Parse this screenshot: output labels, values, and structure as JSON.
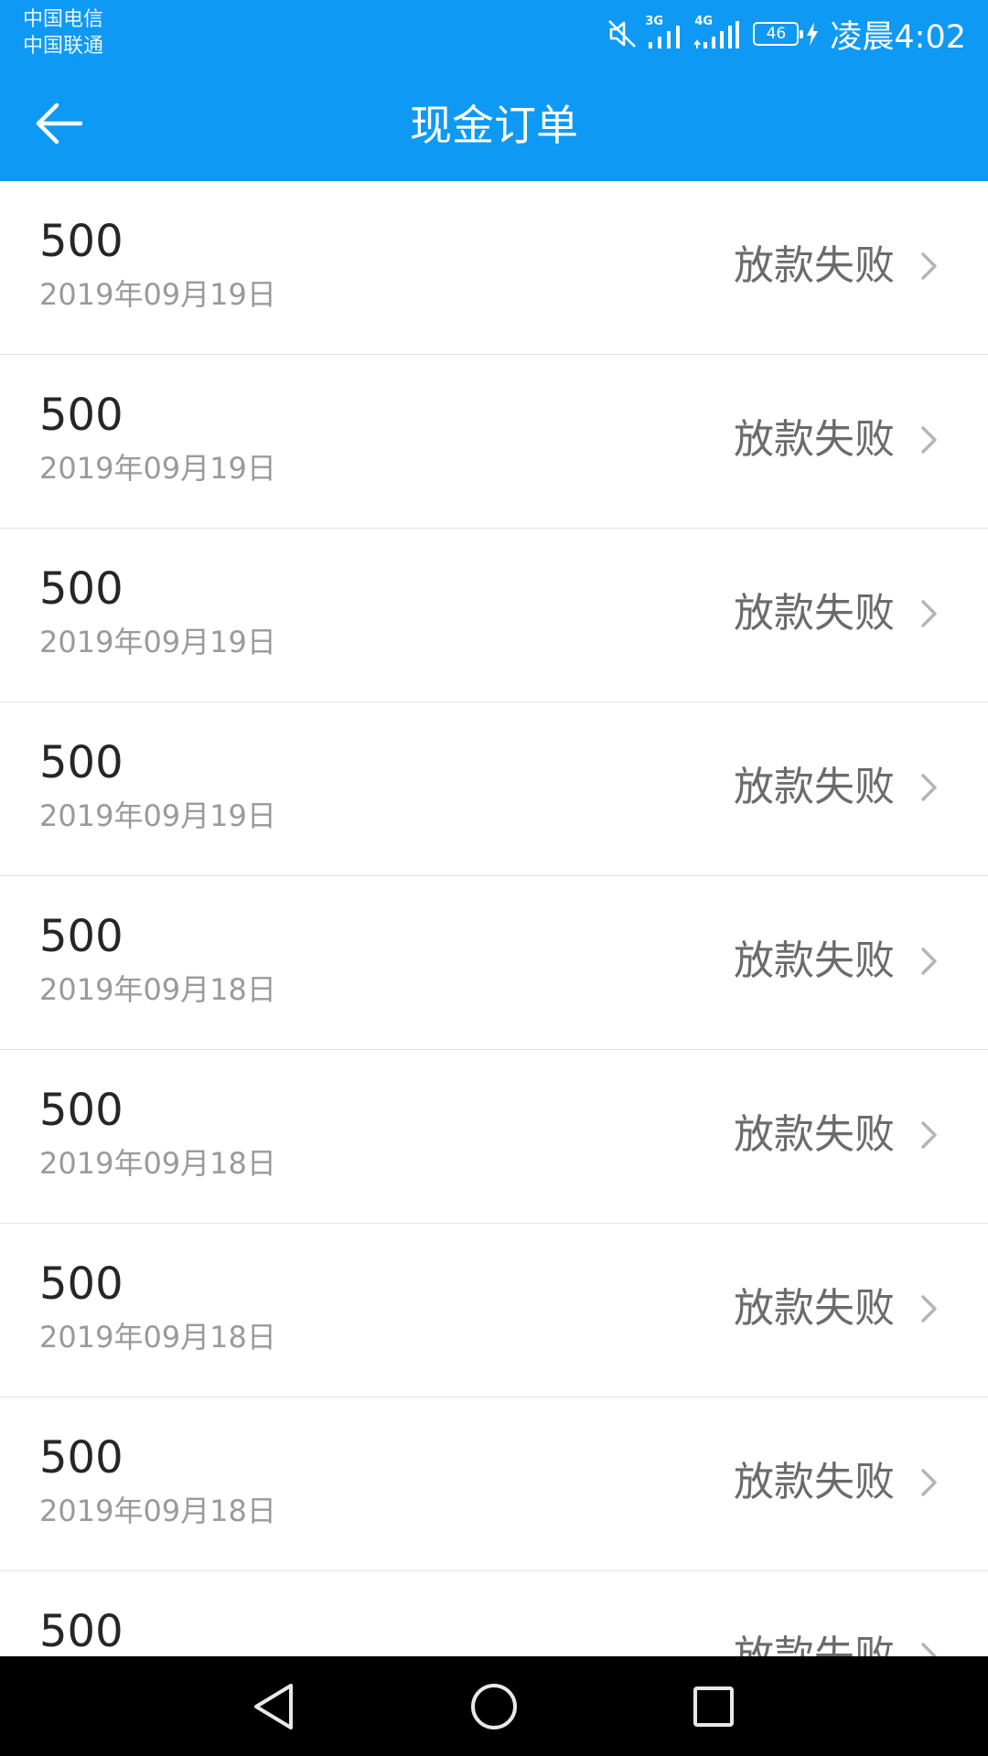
{
  "status_bar": {
    "carrier_1": "中国电信",
    "carrier_2": "中国联通",
    "net_type_1": "3G",
    "net_type_2": "4G",
    "battery_level": "46",
    "time": "凌晨4:02",
    "icons": [
      "mute-icon",
      "signal-3g-icon",
      "signal-4g-icon",
      "battery-icon",
      "charging-icon"
    ]
  },
  "header": {
    "title": "现金订单",
    "back_icon": "arrow-left-icon"
  },
  "colors": {
    "primary": "#0e99f4",
    "amount_text": "#262626",
    "date_text": "#9a9a9a",
    "status_text": "#6b6b6b",
    "divider": "#e3e3e3"
  },
  "orders": [
    {
      "amount": "500",
      "date": "2019年09月19日",
      "status": "放款失败"
    },
    {
      "amount": "500",
      "date": "2019年09月19日",
      "status": "放款失败"
    },
    {
      "amount": "500",
      "date": "2019年09月19日",
      "status": "放款失败"
    },
    {
      "amount": "500",
      "date": "2019年09月19日",
      "status": "放款失败"
    },
    {
      "amount": "500",
      "date": "2019年09月18日",
      "status": "放款失败"
    },
    {
      "amount": "500",
      "date": "2019年09月18日",
      "status": "放款失败"
    },
    {
      "amount": "500",
      "date": "2019年09月18日",
      "status": "放款失败"
    },
    {
      "amount": "500",
      "date": "2019年09月18日",
      "status": "放款失败"
    },
    {
      "amount": "500",
      "date": "",
      "status": "放款失败"
    }
  ],
  "nav_bar": {
    "buttons": [
      "back-triangle-icon",
      "home-circle-icon",
      "recents-square-icon"
    ]
  }
}
